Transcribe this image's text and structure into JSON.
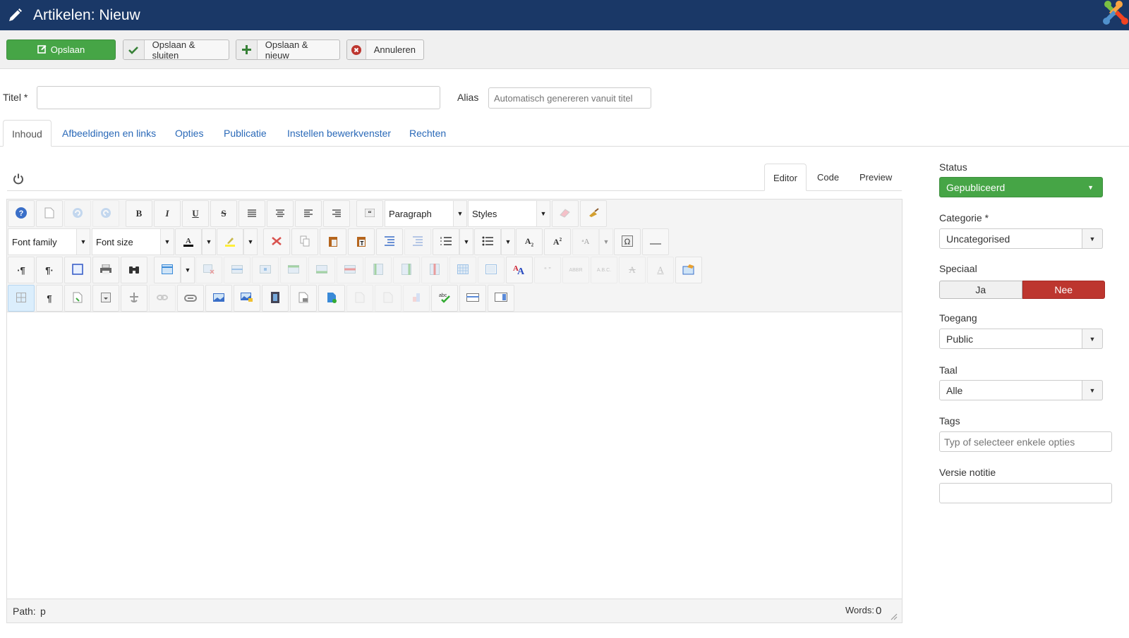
{
  "header": {
    "title": "Artikelen: Nieuw",
    "icon": "pencil-icon",
    "logo": "joomla-logo"
  },
  "toolbar": {
    "save": {
      "label": "Opslaan",
      "icon": "edit-icon"
    },
    "save_close": {
      "label": "Opslaan & sluiten",
      "icon": "check-icon"
    },
    "save_new": {
      "label": "Opslaan & nieuw",
      "icon": "plus-icon"
    },
    "cancel": {
      "label": "Annuleren",
      "icon": "cancel-circle-icon"
    }
  },
  "form": {
    "title_label": "Titel *",
    "title_value": "",
    "alias_label": "Alias",
    "alias_placeholder": "Automatisch genereren vanuit titel"
  },
  "tabs": [
    {
      "label": "Inhoud",
      "active": true
    },
    {
      "label": "Afbeeldingen en links"
    },
    {
      "label": "Opties"
    },
    {
      "label": "Publicatie"
    },
    {
      "label": "Instellen bewerkvenster"
    },
    {
      "label": "Rechten"
    }
  ],
  "editor": {
    "mode_tabs": [
      {
        "label": "Editor",
        "active": true
      },
      {
        "label": "Code"
      },
      {
        "label": "Preview"
      }
    ],
    "toolbar": {
      "format_select": "Paragraph",
      "styles_select": "Styles",
      "font_family": "Font family",
      "font_size": "Font size",
      "bold": "B",
      "italic": "I",
      "underline": "U",
      "strike": "S"
    },
    "status": {
      "path_label": "Path:",
      "path_value": "p",
      "words_label": "Words:",
      "words_value": "0"
    }
  },
  "sidebar": {
    "status": {
      "label": "Status",
      "value": "Gepubliceerd",
      "color": "#46a546"
    },
    "category": {
      "label": "Categorie *",
      "value": "Uncategorised"
    },
    "featured": {
      "label": "Speciaal",
      "yes": "Ja",
      "no": "Nee",
      "selected": "Nee",
      "selected_color": "#bd362f"
    },
    "access": {
      "label": "Toegang",
      "value": "Public"
    },
    "language": {
      "label": "Taal",
      "value": "Alle"
    },
    "tags": {
      "label": "Tags",
      "placeholder": "Typ of selecteer enkele opties"
    },
    "version_note": {
      "label": "Versie notitie",
      "value": ""
    }
  },
  "colors": {
    "header_bg": "#1a3867",
    "link": "#2a69b8",
    "success": "#46a546",
    "danger": "#bd362f"
  }
}
